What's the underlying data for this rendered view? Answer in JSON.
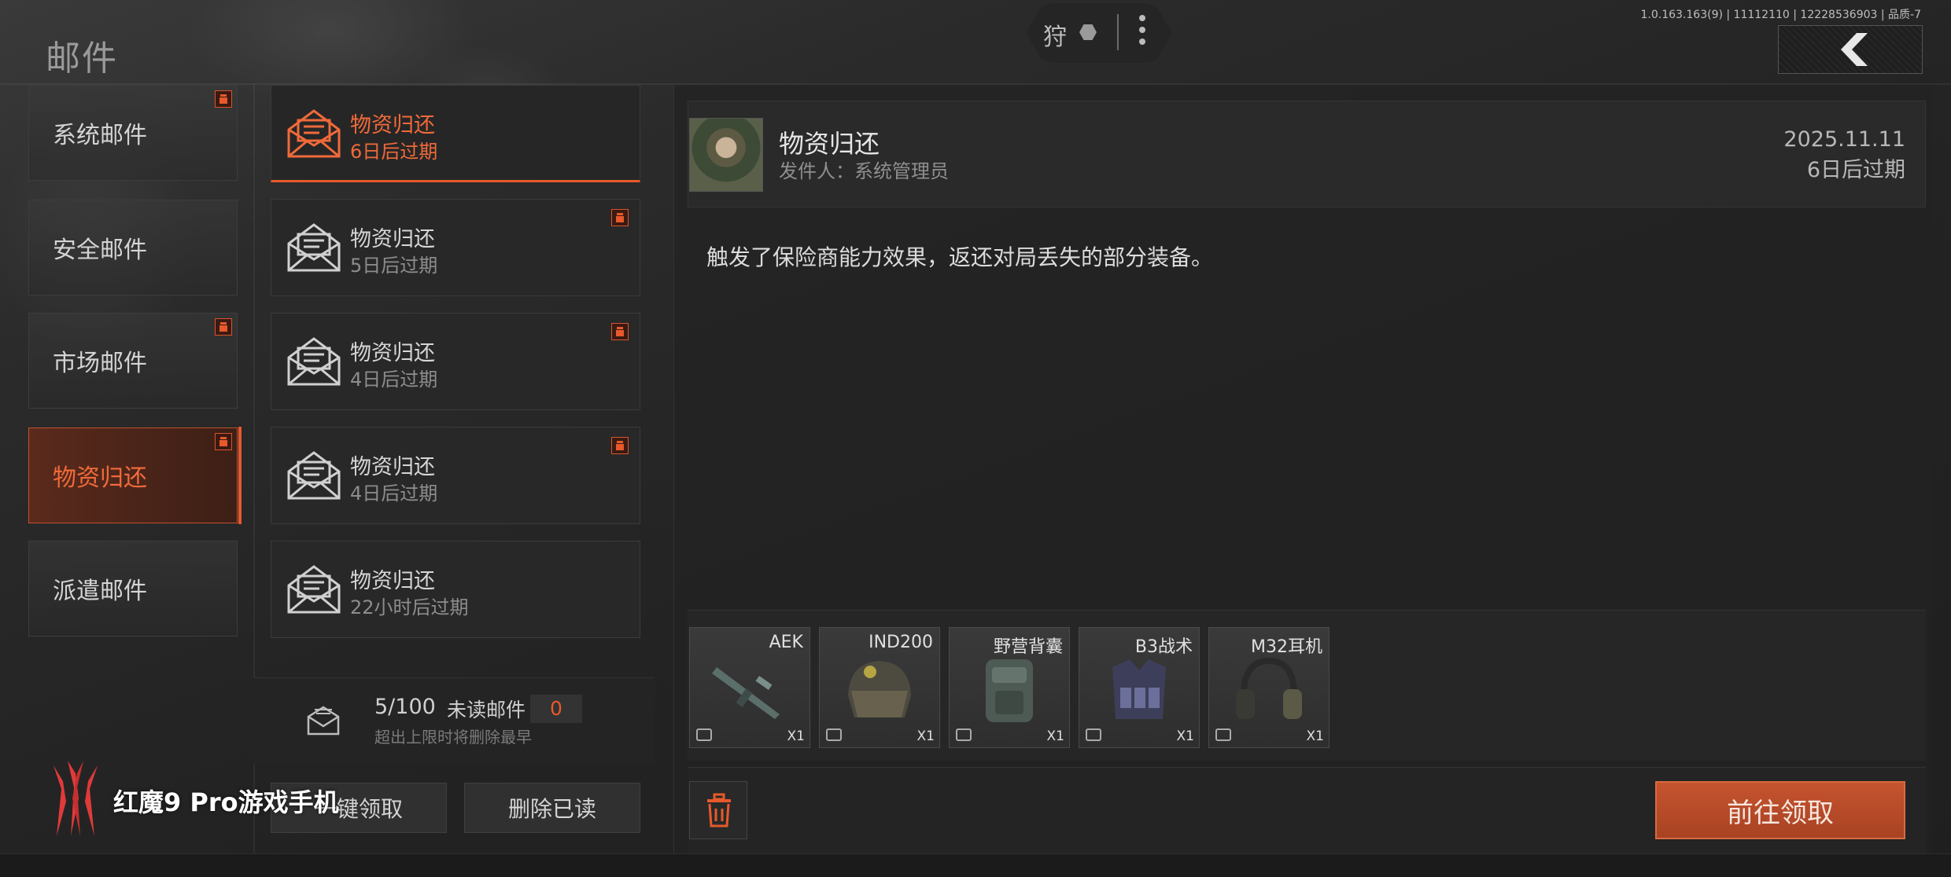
{
  "header": {
    "title": "邮件",
    "pill_char": "狩",
    "version": "1.0.163.163(9) | 11112110 | 12228536903 | 品质-7"
  },
  "categories": [
    {
      "label": "系统邮件",
      "gift": true,
      "active": false
    },
    {
      "label": "安全邮件",
      "gift": false,
      "active": false
    },
    {
      "label": "市场邮件",
      "gift": true,
      "active": false
    },
    {
      "label": "物资归还",
      "gift": true,
      "active": true
    },
    {
      "label": "派遣邮件",
      "gift": false,
      "active": false
    }
  ],
  "mails": [
    {
      "title": "物资归还",
      "expire": "6日后过期",
      "gift": false,
      "active": true
    },
    {
      "title": "物资归还",
      "expire": "5日后过期",
      "gift": true,
      "active": false
    },
    {
      "title": "物资归还",
      "expire": "4日后过期",
      "gift": true,
      "active": false
    },
    {
      "title": "物资归还",
      "expire": "4日后过期",
      "gift": true,
      "active": false
    },
    {
      "title": "物资归还",
      "expire": "22小时后过期",
      "gift": false,
      "active": false
    }
  ],
  "stats": {
    "count": "5/100",
    "unread_label": "未读邮件",
    "unread_count": "0",
    "hint": "超出上限时将删除最早"
  },
  "actions": {
    "claim_all": "一键领取",
    "delete_read": "删除已读",
    "go_claim": "前往领取"
  },
  "brand": {
    "text": "红魔9 Pro游戏手机"
  },
  "detail": {
    "title": "物资归还",
    "sender": "发件人：系统管理员",
    "date": "2025.11.11",
    "expire": "6日后过期",
    "body": "触发了保险商能力效果，返还对局丢失的部分装备。",
    "attachments": [
      {
        "name": "AEK",
        "qty": "X1",
        "icon": "rifle-icon"
      },
      {
        "name": "IND200",
        "qty": "X1",
        "icon": "helmet-icon"
      },
      {
        "name": "野营背囊",
        "qty": "X1",
        "icon": "backpack-icon"
      },
      {
        "name": "B3战术",
        "qty": "X1",
        "icon": "tactical-vest-icon"
      },
      {
        "name": "M32耳机",
        "qty": "X1",
        "icon": "headset-icon"
      }
    ]
  },
  "colors": {
    "accent": "#e8592b",
    "background": "#232323",
    "panel": "#282828"
  }
}
